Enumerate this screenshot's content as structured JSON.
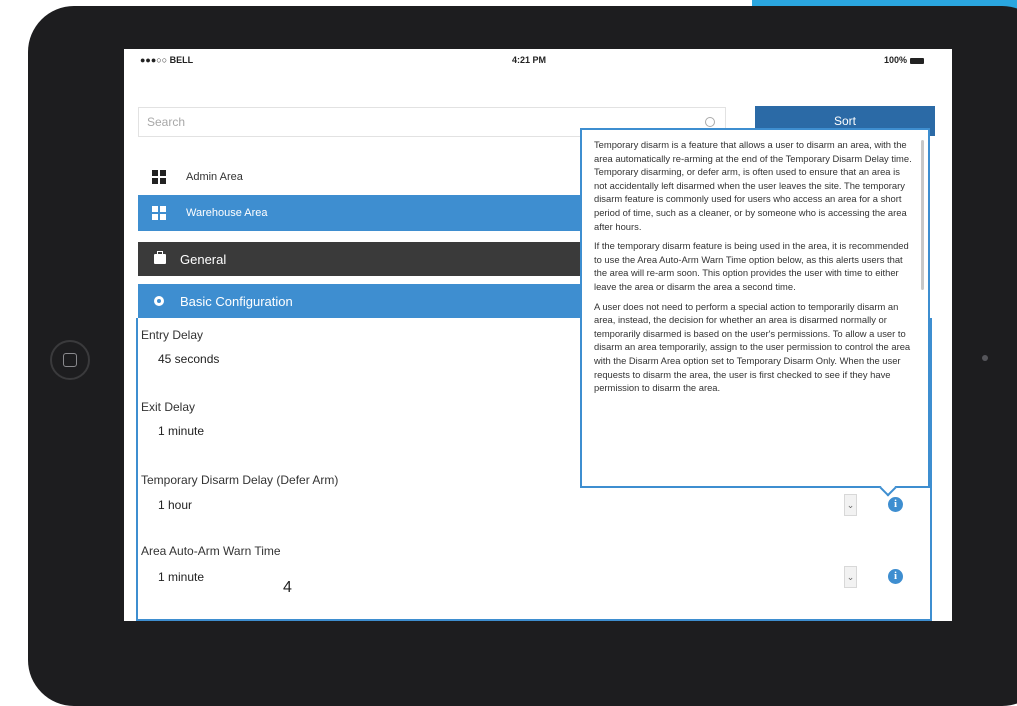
{
  "status_bar": {
    "carrier": "●●●○○ BELL",
    "time": "4:21 PM",
    "battery": "100%"
  },
  "search": {
    "placeholder": "Search"
  },
  "sort_button": "Sort",
  "areas": [
    {
      "label": "Admin Area",
      "icon": "grid-icon",
      "selected": false
    },
    {
      "label": "Warehouse Area",
      "icon": "grid-icon",
      "selected": true
    }
  ],
  "sections": {
    "general": {
      "label": "General",
      "icon": "briefcase-icon"
    },
    "basic": {
      "label": "Basic Configuration",
      "icon": "gear-icon"
    }
  },
  "fields": [
    {
      "label": "Entry Delay",
      "value": "45 seconds"
    },
    {
      "label": "Exit Delay",
      "value": "1 minute"
    },
    {
      "label": "Temporary Disarm Delay (Defer Arm)",
      "value": "1 hour"
    },
    {
      "label": "Area Auto-Arm Warn Time",
      "value": "1 minute"
    }
  ],
  "help_text": {
    "p1": "Temporary disarm is a feature that allows a user to disarm an area, with the area automatically re-arming at the end of the Temporary Disarm Delay time. Temporary disarming, or defer arm, is often used to ensure that an area is not accidentally left disarmed when the user leaves the site. The temporary disarm feature is commonly used for users who access an area for a short period of time, such as a cleaner, or by someone who is accessing the area after hours.",
    "p2": "If the temporary disarm feature is being used in the area, it is recommended to use the Area Auto-Arm Warn Time option below, as this alerts users that the area will re-arm soon. This option provides the user with time to either leave the area or disarm the area a second time.",
    "p3": "A user does not need to perform a special action to temporarily disarm an area, instead, the decision for whether an area is disarmed normally or temporarily disarmed is based on the user's permissions. To allow a user to disarm an area temporarily, assign to the user permission to control the area with the Disarm Area option set to Temporary Disarm Only. When the user requests to disarm the area, the user is first checked to see if they have permission to disarm the area."
  },
  "overlay_number": "4",
  "colors": {
    "accent": "#3e8ed0",
    "sort_button": "#2b6aa6",
    "header_dark": "#3a3a3a",
    "tablet_bezel": "#1d1d1f"
  }
}
